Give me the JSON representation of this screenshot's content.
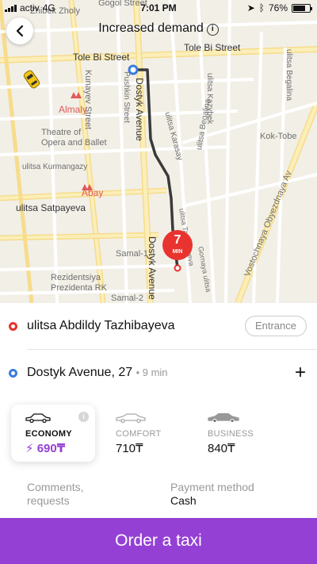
{
  "status_bar": {
    "carrier": "activ",
    "network": "4G",
    "time": "7:01 PM",
    "battery": "76%",
    "battery_level": 0.76
  },
  "header": {
    "title": "Increased demand",
    "info_icon": "info-circle-icon",
    "back_icon": "chevron-left-icon"
  },
  "map": {
    "labels": {
      "zhibek_zholy": "Zhibek Zholy",
      "gogol": "Gogol Street",
      "tole_bi_left": "Tole Bi Street",
      "tole_bi_right": "Tole Bi Street",
      "almaly": "Almaly",
      "theatre": "Theatre of\nOpera and Ballet",
      "kurmangazy": "ulitsa Kurmangazy",
      "abay": "Abay",
      "satpayeva": "ulitsa Satpayeva",
      "samal1": "Samal-1",
      "samal2": "Samal-2",
      "rezidentsiya": "Rezidentsiya\nPrezidenta RK",
      "kunayev": "Kunayev Street",
      "pushkin": "Pushkin Street",
      "dostyk": "Dostyk Avenue",
      "dostyk_lower": "Dostyk Avenue",
      "kazybek": "ulitsa Kazybek",
      "karasay": "ulitsa Karasay",
      "begalina": "ulitsa Begalina",
      "begalina2": "ulitsa Begalina",
      "kok_tobe": "Kok-Tobe",
      "vostochnaya": "Vostochnaya Obyezdnaya Av",
      "gornaya": "Gornaya ulitsa",
      "tazhibayeva": "ulitsa Tazhibayeva"
    },
    "eta": {
      "value": "7",
      "unit": "MIN"
    },
    "colors": {
      "route": "#3a3a3a",
      "badge": "#e8332e",
      "start": "#3a7be0"
    }
  },
  "route": {
    "from": {
      "address": "ulitsa Abdildy Tazhibayeva",
      "entrance_label": "Entrance"
    },
    "to": {
      "address": "Dostyk Avenue, 27",
      "eta_text": "• 9 min",
      "add_icon": "plus-icon"
    }
  },
  "tariffs": [
    {
      "name": "ECONOMY",
      "price": "690₸",
      "selected": true,
      "surge_icon": "lightning-icon"
    },
    {
      "name": "COMFORT",
      "price": "710₸",
      "selected": false
    },
    {
      "name": "BUSINESS",
      "price": "840₸",
      "selected": false
    }
  ],
  "options": {
    "comments_label": "Comments,\nrequests",
    "payment_label": "Payment method",
    "payment_value": "Cash"
  },
  "order_button": {
    "label": "Order a taxi"
  },
  "colors": {
    "accent": "#9440d4",
    "origin_dot": "#e8332e",
    "dest_dot": "#3a7be0"
  }
}
